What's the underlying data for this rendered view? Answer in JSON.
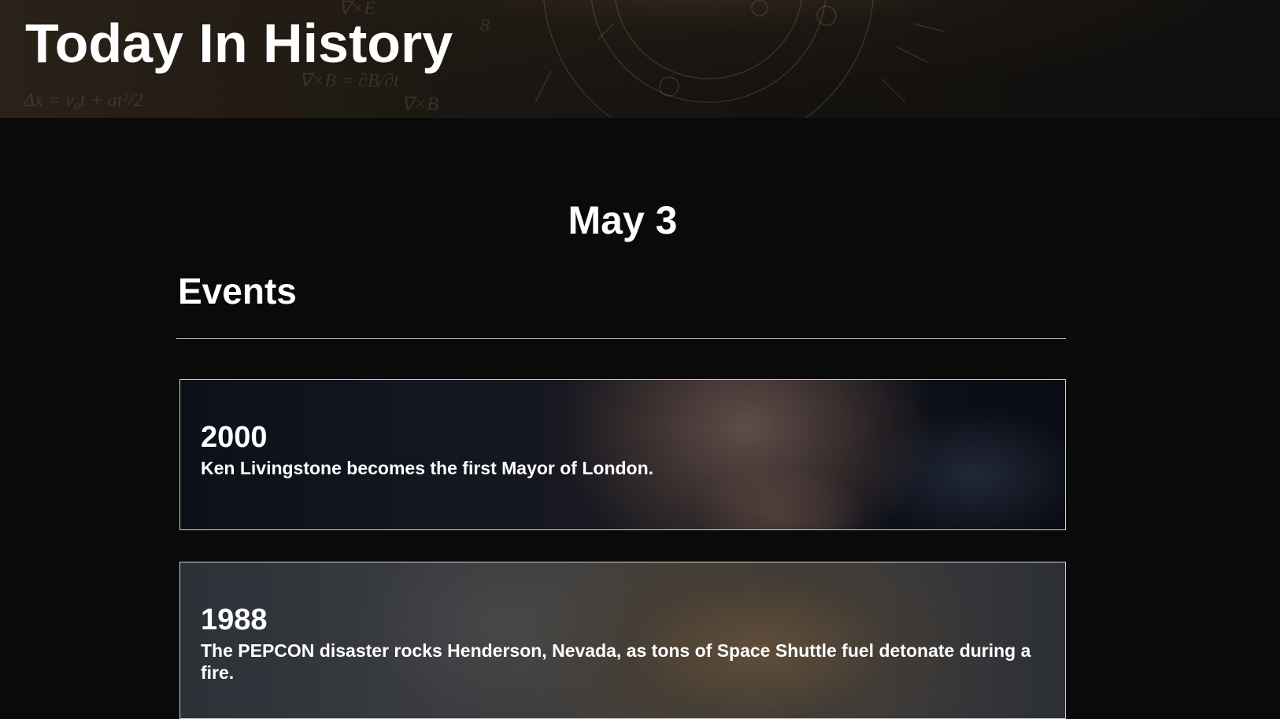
{
  "header": {
    "title": "Today In History"
  },
  "main": {
    "date": "May 3",
    "section_title": "Events",
    "events": [
      {
        "year": "2000",
        "text": "Ken Livingstone becomes the first Mayor of London."
      },
      {
        "year": "1988",
        "text": "The PEPCON disaster rocks Henderson, Nevada, as tons of Space Shuttle fuel detonate during a fire."
      }
    ]
  }
}
